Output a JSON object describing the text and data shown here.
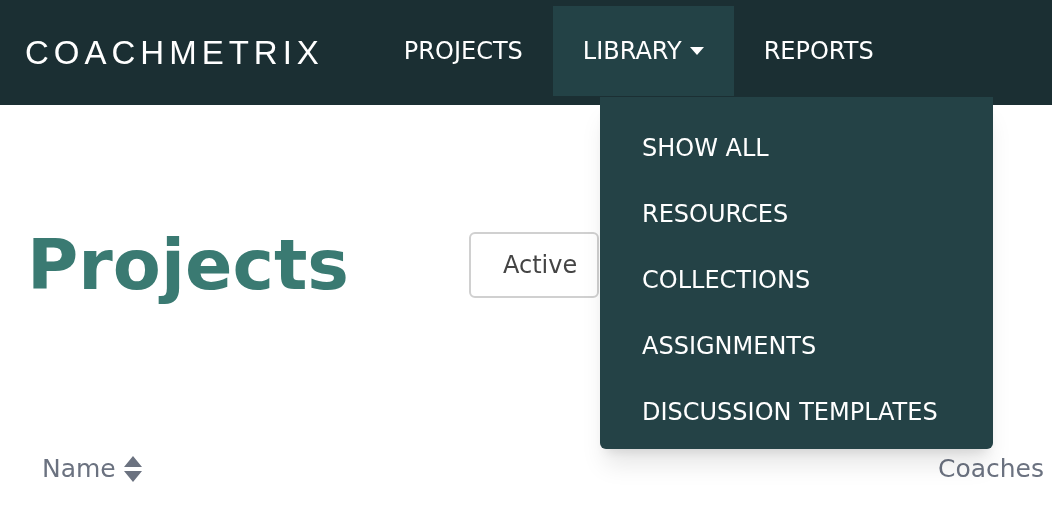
{
  "navbar": {
    "logo": "COACHMETRIX",
    "items": [
      {
        "label": "PROJECTS",
        "kind": "link",
        "expanded": false
      },
      {
        "label": "LIBRARY",
        "kind": "dropdown",
        "expanded": true
      },
      {
        "label": "REPORTS",
        "kind": "link",
        "expanded": false
      }
    ]
  },
  "dropdown_menu": [
    "SHOW ALL",
    "RESOURCES",
    "COLLECTIONS",
    "ASSIGNMENTS",
    "DISCUSSION TEMPLATES"
  ],
  "page": {
    "title": "Projects",
    "filter_button": "Active"
  },
  "table": {
    "columns": [
      "Name",
      "Coaches"
    ]
  }
}
